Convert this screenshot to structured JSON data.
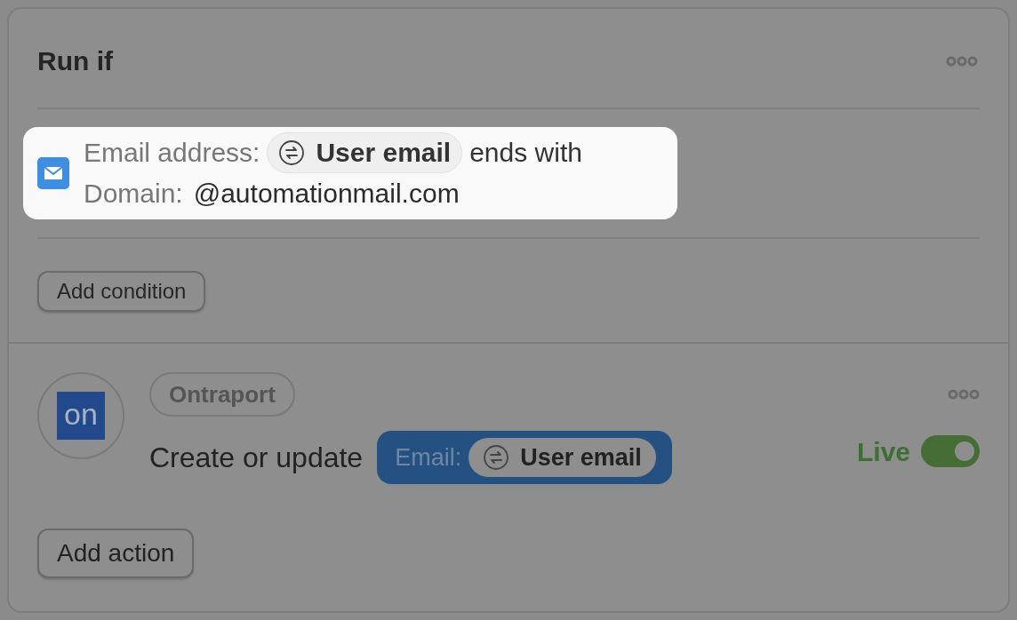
{
  "section": {
    "title": "Run if"
  },
  "condition": {
    "highlighted": true,
    "field_label": "Email address:",
    "field_value": "User email",
    "operator": "ends with",
    "value_label": "Domain:",
    "value": "@automationmail.com"
  },
  "add_condition": "Add condition",
  "action": {
    "app_badge": "Ontraport",
    "app_logo": "on",
    "verb": "Create or update",
    "param_label": "Email:",
    "param_value": "User email",
    "status": "Live",
    "on": true
  },
  "add_action": "Add action"
}
